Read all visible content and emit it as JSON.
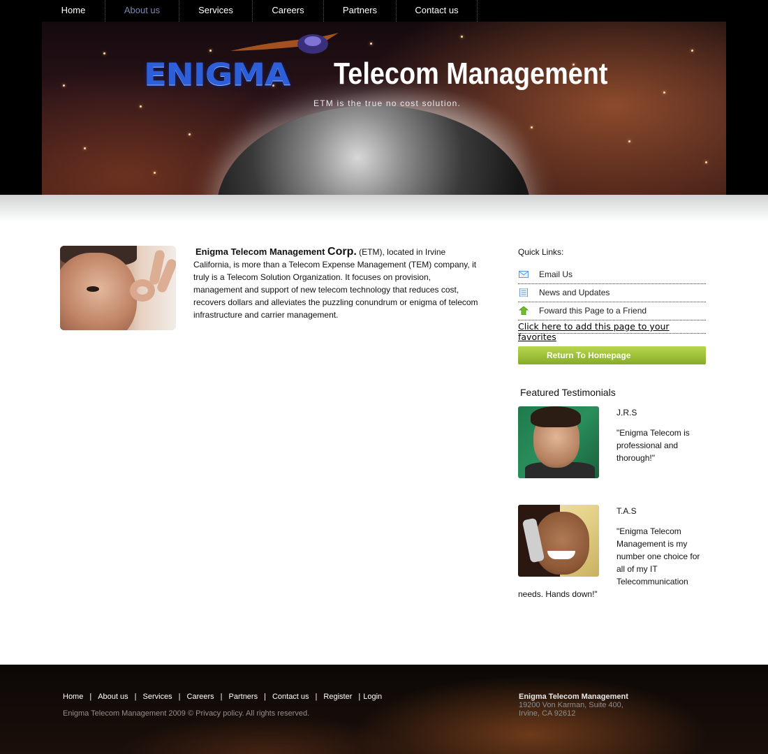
{
  "nav": {
    "items": [
      {
        "label": "Home",
        "active": false
      },
      {
        "label": "About us",
        "active": true
      },
      {
        "label": "Services",
        "active": false
      },
      {
        "label": "Careers",
        "active": false
      },
      {
        "label": "Partners",
        "active": false
      },
      {
        "label": "Contact us",
        "active": false
      }
    ]
  },
  "header": {
    "logo_word": "ENIGMA",
    "logo_title": "Telecom Management",
    "tagline": "ETM is the true no cost solution."
  },
  "intro": {
    "lead_name": "Enigma Telecom Management",
    "lead_corp": "Corp.",
    "body": " (ETM), located in Irvine California, is more than a Telecom Expense Management (TEM) company, it truly is a Telecom Solution Organization. It focuses on provision, management and support of new telecom technology that reduces cost, recovers dollars and alleviates the puzzling conundrum or enigma of telecom infrastructure and carrier management."
  },
  "quick_links": {
    "title": "Quick Links:",
    "items": [
      {
        "label": "Email Us",
        "icon": "envelope-icon"
      },
      {
        "label": "News and Updates",
        "icon": "document-icon"
      },
      {
        "label": "Foward this Page to a Friend",
        "icon": "forward-arrow-icon"
      }
    ],
    "favorites": "Click here to add this page to your favorites",
    "return_button": "Return To Homepage"
  },
  "testimonials": {
    "title": "Featured Testimonials",
    "items": [
      {
        "name": "J.R.S",
        "quote": "\"Enigma Telecom is professional and thorough!\""
      },
      {
        "name": "T.A.S",
        "quote_a": "\"Enigma Telecom Management is my number one choice for all of my IT Telecommunication",
        "quote_b": "needs. Hands down!\""
      }
    ]
  },
  "footer": {
    "links": [
      "Home",
      "About us",
      "Services",
      "Careers",
      "Partners",
      "Contact us",
      "Register",
      "Login"
    ],
    "separator": "|",
    "copyright": "Enigma Telecom Management 2009 © Privacy policy.  All rights reserved.",
    "company": "Enigma Telecom Management",
    "address_line1": "19200 Von Karman, Suite 400,",
    "address_line2": "Irvine, CA 92612"
  },
  "colors": {
    "nav_bg": "#000000",
    "nav_active": "#7d86b0",
    "button_green": "#9dc03a",
    "logo_blue": "#2c5fd8"
  }
}
